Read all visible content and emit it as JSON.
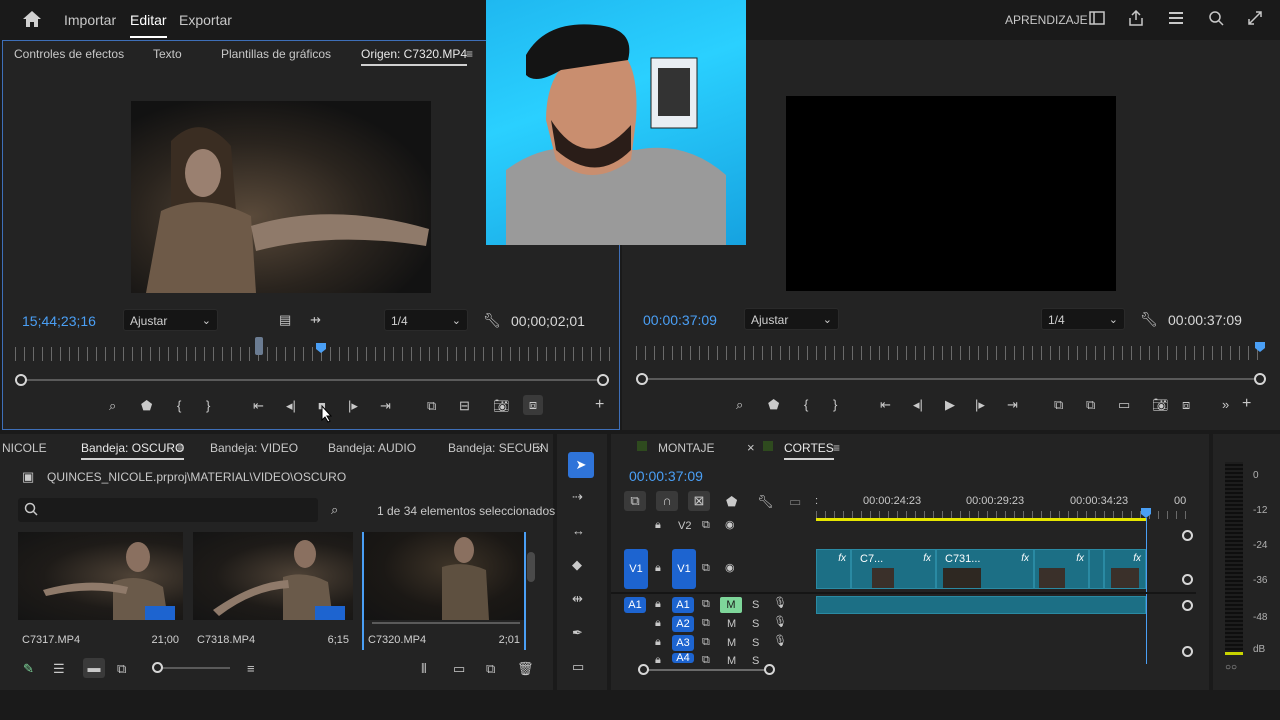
{
  "topbar": {
    "home_icon": "home-icon",
    "nav": [
      "Importar",
      "Editar",
      "Exportar"
    ],
    "active_nav": "Editar",
    "learn_label": "APRENDIZAJE",
    "icons": [
      "panel-layout-icon",
      "share-icon",
      "workspaces-icon",
      "search-icon",
      "expand-icon"
    ]
  },
  "source_panel": {
    "tabs": [
      "Controles de efectos",
      "Texto",
      "Plantillas de gráficos",
      "Origen: C7320.MP4"
    ],
    "active_tab": "Origen: C7320.MP4",
    "timecode": "15;44;23;16",
    "fit_label": "Ajustar",
    "resolution": "1/4",
    "duration": "00;00;02;01"
  },
  "program_panel": {
    "timecode": "00:00:37:09",
    "fit_label": "Ajustar",
    "resolution": "1/4",
    "duration": "00:00:37:09"
  },
  "project_panel": {
    "tabs": [
      "NICOLE",
      "Bandeja: OSCURO",
      "Bandeja: VIDEO",
      "Bandeja: AUDIO",
      "Bandeja: SECUEN"
    ],
    "active_tab": "Bandeja: OSCURO",
    "path": "QUINCES_NICOLE.prproj\\MATERIAL\\VIDEO\\OSCURO",
    "selection_count": "1 de 34 elementos seleccionados",
    "search_placeholder": "",
    "items": [
      {
        "name": "C7317.MP4",
        "duration": "21;00"
      },
      {
        "name": "C7318.MP4",
        "duration": "6;15"
      },
      {
        "name": "C7320.MP4",
        "duration": "2;01"
      }
    ]
  },
  "timeline_panel": {
    "tabs": [
      "MONTAJE",
      "CORTES"
    ],
    "active_tab": "CORTES",
    "timecode": "00:00:37:09",
    "ruler_labels": [
      ":",
      "00:00:24:23",
      "00:00:29:23",
      "00:00:34:23",
      "00"
    ],
    "tracks": {
      "v2": "V2",
      "v1_src": "V1",
      "v1": "V1",
      "a1_src": "A1",
      "a1": "A1",
      "a2": "A2",
      "a3": "A3",
      "a4": "A4",
      "m": "M",
      "s": "S"
    },
    "clips": [
      {
        "label": "",
        "fx": "fx"
      },
      {
        "label": "C7...",
        "fx": "fx"
      },
      {
        "label": "C731...",
        "fx": "fx"
      },
      {
        "label": "",
        "fx": "fx"
      },
      {
        "label": "",
        "fx": ""
      },
      {
        "label": "",
        "fx": "fx"
      }
    ]
  },
  "meter": {
    "ticks": [
      "0",
      "-12",
      "-24",
      "-36",
      "-48",
      "dB"
    ],
    "solo_label": "○○"
  },
  "colors": {
    "accent_blue": "#4a9ff5",
    "clip_teal": "#1c6f85",
    "track_blue": "#1d64d0",
    "mute_green": "#7ed69a",
    "workarea_yellow": "#e6e600"
  }
}
